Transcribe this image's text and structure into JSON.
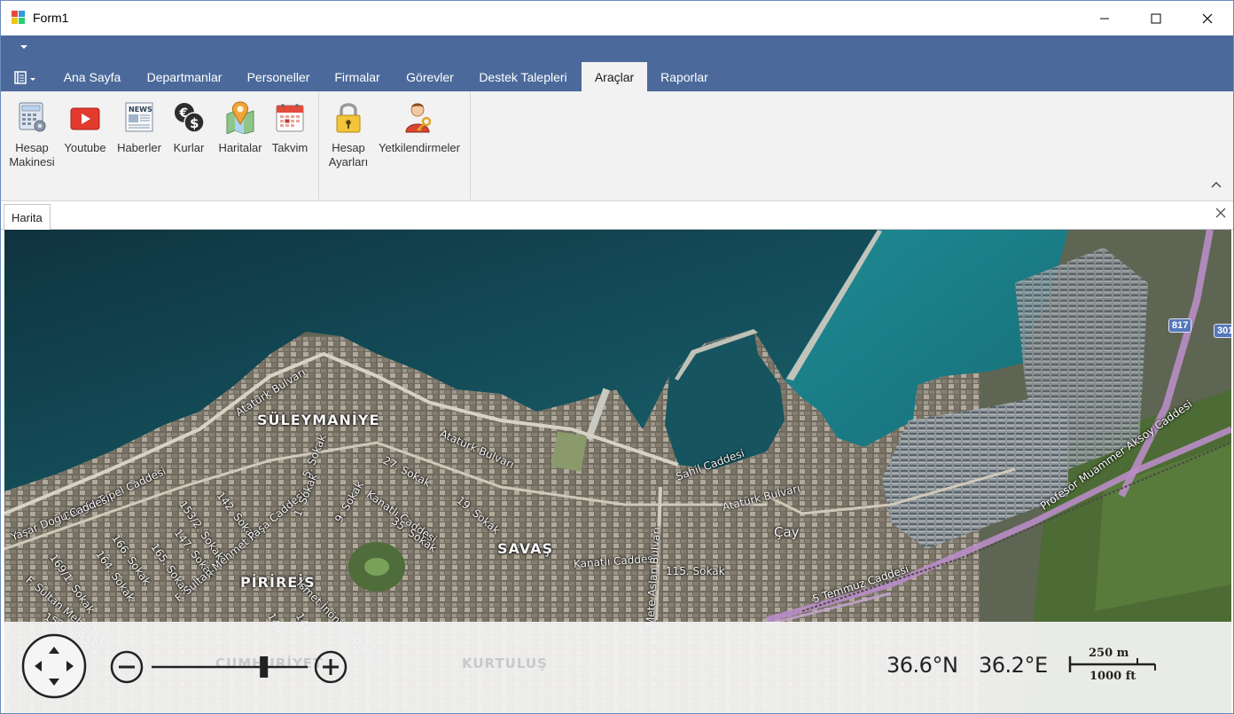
{
  "window": {
    "title": "Form1"
  },
  "ribbon": {
    "tabs": [
      {
        "label": "Ana Sayfa"
      },
      {
        "label": "Departmanlar"
      },
      {
        "label": "Personeller"
      },
      {
        "label": "Firmalar"
      },
      {
        "label": "Görevler"
      },
      {
        "label": "Destek Talepleri"
      },
      {
        "label": "Araçlar",
        "active": true
      },
      {
        "label": "Raporlar"
      }
    ],
    "items": [
      {
        "line1": "Hesap",
        "line2": "Makinesi",
        "icon": "calculator-icon"
      },
      {
        "line1": "Youtube",
        "line2": "",
        "icon": "youtube-icon"
      },
      {
        "line1": "Haberler",
        "line2": "",
        "icon": "news-icon"
      },
      {
        "line1": "Kurlar",
        "line2": "",
        "icon": "currency-icon"
      },
      {
        "line1": "Haritalar",
        "line2": "",
        "icon": "map-pin-icon"
      },
      {
        "line1": "Takvim",
        "line2": "",
        "icon": "calendar-icon"
      },
      {
        "line1": "Hesap",
        "line2": "Ayarları",
        "icon": "lock-icon"
      },
      {
        "line1": "Yetkilendirmeler",
        "line2": "",
        "icon": "user-key-icon"
      }
    ]
  },
  "document": {
    "tab_label": "Harita"
  },
  "map": {
    "labels": {
      "ataturk1": "Atatürk Bulvarı",
      "suleymaniye": "SÜLEYMANİYE",
      "ataturk2": "Atatürk Bulvarı",
      "sahil": "Sahil Caddesi",
      "ataturk3": "Atatürk Bulvarı",
      "cengiz": "Cengiz Topel Caddesi",
      "yasar": "Yaşar Doğu Caddesi",
      "sok27": "27. Sokak",
      "sok19": "19. Sokak",
      "kanatli1": "Kanatlı Caddesi",
      "sok35": "35. Sokak",
      "savas": "SAVAŞ",
      "cay": "Çay",
      "kanatli2": "Kanatlı Caddesi",
      "sok115": "115. Sokak",
      "mete": "Mete Aslan Bulvarı",
      "sok142": "142. Sokak",
      "sok153": "153/2. Sokak",
      "sok147": "147. Sokak",
      "sok166": "166. Sokak",
      "sok165": "165. Sokak",
      "sok164": "164. Sokak",
      "sok169": "169/1. Sokak",
      "fsultan": "F. Sultan Mehmet Caddesi",
      "fsultan2": "F. Sultan Mehmet Paşa Caddesi",
      "pirireis": "PİRİREİS",
      "inonu": "İsmet İnönü Caddesi",
      "temmuz": "5 Temmuz Caddesi",
      "profesor": "Profesör Muammer Aksoy Caddesi",
      "sok153b": "153. Sokak",
      "shield817": "817",
      "shield301": "301",
      "sok1": "1. Sokak",
      "sok5": "5. Sokak",
      "sok9": "9. Sokak",
      "sok146": "146",
      "sok144": "144"
    },
    "ghost_labels": {
      "kurtulus": "KURTULUŞ",
      "cumhuriyet": "CUMHURİYET"
    },
    "latitude": "36.6°N",
    "longitude": "36.2°E",
    "scale_metric": "250 m",
    "scale_imperial": "1000 ft",
    "zoom_level": 0.72
  }
}
